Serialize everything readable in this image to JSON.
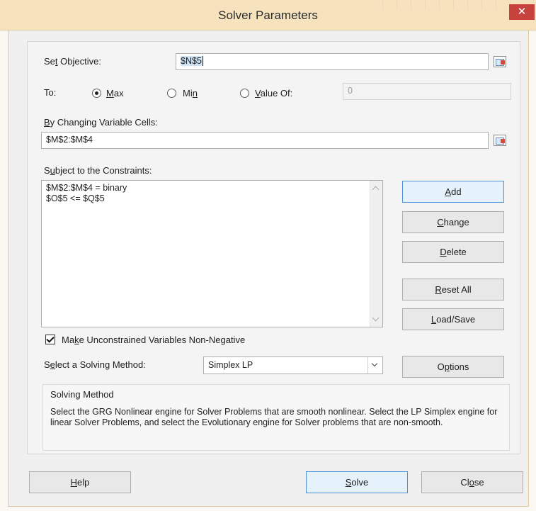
{
  "window": {
    "title": "Solver Parameters",
    "close_glyph": "✕"
  },
  "objective": {
    "label_pre": "Se",
    "label_u": "t",
    "label_post": " Objective:",
    "value": "$N$5"
  },
  "to": {
    "label": "To:",
    "max": {
      "pre": "",
      "u": "M",
      "post": "ax",
      "selected": true
    },
    "min": {
      "pre": "Mi",
      "u": "n",
      "post": "",
      "selected": false
    },
    "value_of": {
      "pre": "",
      "u": "V",
      "post": "alue Of:",
      "selected": false
    },
    "value_field": "0"
  },
  "changing_cells": {
    "label_pre": "",
    "label_u": "B",
    "label_post": "y Changing Variable Cells:",
    "value": "$M$2:$M$4"
  },
  "constraints": {
    "label_pre": "S",
    "label_u": "u",
    "label_post": "bject to the Constraints:",
    "items": [
      "$M$2:$M$4 = binary",
      "$O$5 <= $Q$5"
    ]
  },
  "side_buttons": {
    "add": {
      "pre": "",
      "u": "A",
      "post": "dd"
    },
    "change": {
      "pre": "",
      "u": "C",
      "post": "hange"
    },
    "delete": {
      "pre": "",
      "u": "D",
      "post": "elete"
    },
    "reset_all": {
      "pre": "",
      "u": "R",
      "post": "eset All"
    },
    "load_save": {
      "pre": "",
      "u": "L",
      "post": "oad/Save"
    },
    "options": {
      "pre": "O",
      "u": "p",
      "post": "tions"
    }
  },
  "nonneg": {
    "pre": "Ma",
    "u": "k",
    "post": "e Unconstrained Variables Non-Negative",
    "checked": true
  },
  "method": {
    "label_pre": "S",
    "label_u": "e",
    "label_post": "lect a Solving Method:",
    "selected": "Simplex LP"
  },
  "solving_info": {
    "heading": "Solving Method",
    "text": "Select the GRG Nonlinear engine for Solver Problems that are smooth nonlinear. Select the LP Simplex engine for linear Solver Problems, and select the Evolutionary engine for Solver problems that are non-smooth."
  },
  "footer": {
    "help": {
      "pre": "",
      "u": "H",
      "post": "elp"
    },
    "solve": {
      "pre": "",
      "u": "S",
      "post": "olve"
    },
    "close": {
      "pre": "Cl",
      "u": "o",
      "post": "se"
    }
  }
}
